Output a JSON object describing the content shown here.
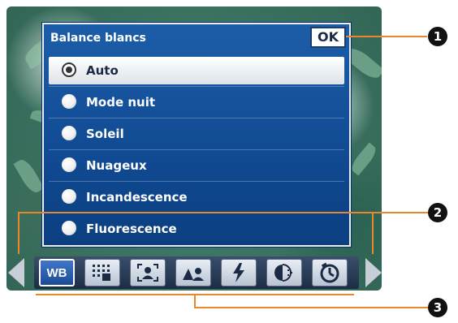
{
  "menu": {
    "title": "Balance blancs",
    "ok_label": "OK",
    "options": [
      {
        "label": "Auto",
        "selected": true
      },
      {
        "label": "Mode nuit",
        "selected": false
      },
      {
        "label": "Soleil",
        "selected": false
      },
      {
        "label": "Nuageux",
        "selected": false
      },
      {
        "label": "Incandescence",
        "selected": false
      },
      {
        "label": "Fluorescence",
        "selected": false
      }
    ]
  },
  "toolbar": {
    "items": [
      {
        "label": "WB",
        "icon": "white-balance",
        "active": true
      },
      {
        "icon": "metering-grid-icon"
      },
      {
        "icon": "portrait-focus-icon"
      },
      {
        "icon": "scene-mode-icon"
      },
      {
        "icon": "flash-icon"
      },
      {
        "icon": "exposure-compensation-icon"
      },
      {
        "icon": "self-timer-icon"
      }
    ]
  },
  "callouts": [
    "1",
    "2",
    "3"
  ],
  "colors": {
    "menu_blue": "#104a92",
    "callout_orange": "#e8882b"
  }
}
